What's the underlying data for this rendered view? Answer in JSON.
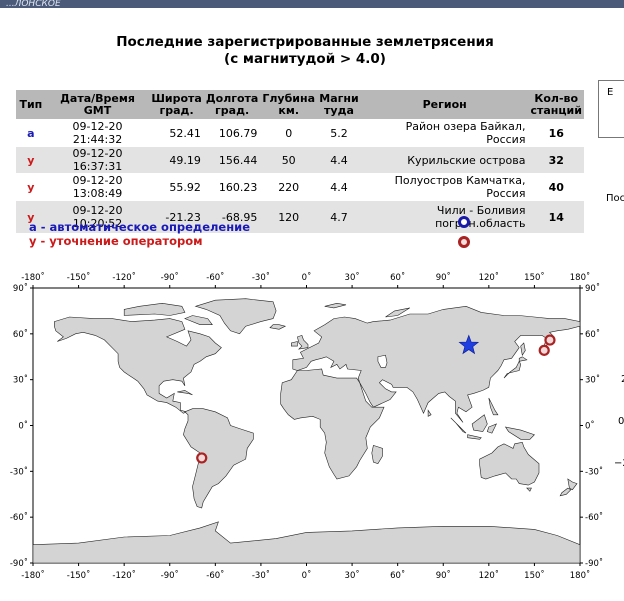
{
  "top_strip_text": "...ЛОНСКОЕ",
  "title_line1": "Последние зарегистрированные землетрясения",
  "title_line2": "(с магнитудой > 4.0)",
  "table": {
    "headers": {
      "type": "Тип",
      "datetime": "Дата/Время GMT",
      "lat": "Широта\nград.",
      "lon": "Долгота\nград.",
      "depth": "Глубина\nкм.",
      "mag": "Магни\nтуда",
      "region": "Регион",
      "stations": "Кол-во\nстанций"
    },
    "rows": [
      {
        "type": "a",
        "datetime": "09-12-20 21:44:32",
        "lat": "52.41",
        "lon": "106.79",
        "depth": "0",
        "mag": "5.2",
        "region": "Район озера Байкал, Россия",
        "stations": "16"
      },
      {
        "type": "y",
        "datetime": "09-12-20 16:37:31",
        "lat": "49.19",
        "lon": "156.44",
        "depth": "50",
        "mag": "4.4",
        "region": "Курильские острова",
        "stations": "32"
      },
      {
        "type": "y",
        "datetime": "09-12-20 13:08:49",
        "lat": "55.92",
        "lon": "160.23",
        "depth": "220",
        "mag": "4.4",
        "region": "Полуостров Камчатка, Россия",
        "stations": "40"
      },
      {
        "type": "y",
        "datetime": "09-12-20 10:20:52",
        "lat": "-21.23",
        "lon": "-68.95",
        "depth": "120",
        "mag": "4.7",
        "region": "Чили - Боливия\nпогран.область",
        "stations": "14"
      }
    ]
  },
  "legend": {
    "auto": "а - автоматическое определение",
    "operator": "у - уточнение оператором"
  },
  "right_fragments": {
    "box_letter": "Е",
    "cut_text": "Пос",
    "tick_a": "2",
    "tick_b": "0",
    "tick_c": "−2"
  },
  "map": {
    "lon_ticks": [
      "-180˚",
      "-150˚",
      "-120˚",
      "-90˚",
      "-60˚",
      "-30˚",
      "0˚",
      "30˚",
      "60˚",
      "90˚",
      "120˚",
      "150˚",
      "180˚"
    ],
    "lat_ticks": [
      "90˚",
      "60˚",
      "30˚",
      "0˚",
      "-30˚",
      "-60˚",
      "-90˚"
    ],
    "events": [
      {
        "lat": 52.41,
        "lon": 106.79,
        "kind": "a"
      },
      {
        "lat": 49.19,
        "lon": 156.44,
        "kind": "y"
      },
      {
        "lat": 55.92,
        "lon": 160.23,
        "kind": "y"
      },
      {
        "lat": -21.23,
        "lon": -68.95,
        "kind": "y"
      }
    ],
    "colors": {
      "land": "#d4d4d4",
      "ocean": "#ffffff",
      "star": "#1f3fe0",
      "ring": "#aa2222"
    }
  }
}
